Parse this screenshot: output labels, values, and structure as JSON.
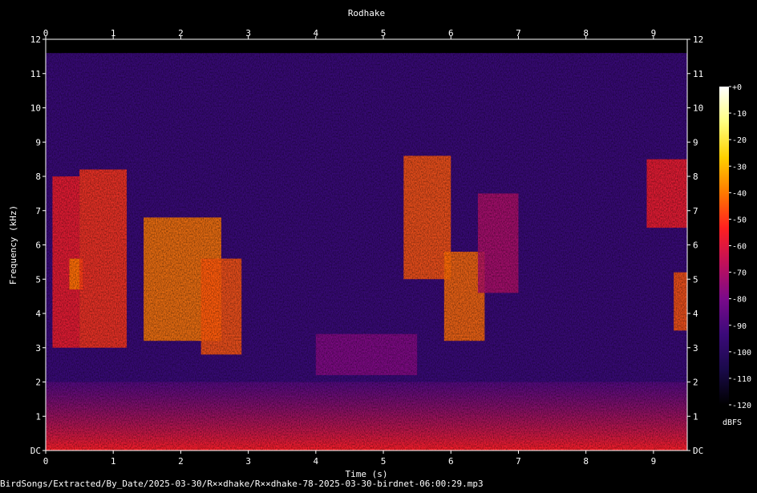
{
  "chart_data": {
    "type": "heatmap",
    "title": "Rodhake",
    "xlabel": "Time (s)",
    "ylabel": "Frequency (kHz)",
    "xlim": [
      0,
      9.5
    ],
    "ylim": [
      0,
      12
    ],
    "x_ticks": [
      "0",
      "1",
      "2",
      "3",
      "4",
      "5",
      "6",
      "7",
      "8",
      "9"
    ],
    "y_ticks": [
      "DC",
      "1",
      "2",
      "3",
      "4",
      "5",
      "6",
      "7",
      "8",
      "9",
      "10",
      "11",
      "12"
    ],
    "colorbar": {
      "label": "dBFS",
      "ticks": [
        "+0",
        "-10",
        "-20",
        "-30",
        "-40",
        "-50",
        "-60",
        "-70",
        "-80",
        "-90",
        "-100",
        "-110",
        "-120"
      ],
      "range": [
        -120,
        0
      ],
      "colors": [
        "#000000",
        "#1a0a4a",
        "#3b0a7a",
        "#7a0a8a",
        "#c0105a",
        "#ff2020",
        "#ff7a00",
        "#ffd000",
        "#ffff80",
        "#ffffff"
      ]
    },
    "background_dbfs": -95,
    "noise_ceiling_khz": 11.6,
    "low_band": {
      "khz_range": [
        0,
        2
      ],
      "dbfs_at_dc": -55,
      "dbfs_at_2khz": -85
    },
    "calls": [
      {
        "t": [
          0.1,
          0.5
        ],
        "khz": [
          3,
          8
        ],
        "peak_dbfs": -55
      },
      {
        "t": [
          0.35,
          0.55
        ],
        "khz": [
          4.7,
          5.6
        ],
        "peak_dbfs": -40
      },
      {
        "t": [
          0.5,
          1.2
        ],
        "khz": [
          3,
          8.2
        ],
        "peak_dbfs": -50
      },
      {
        "t": [
          1.45,
          2.6
        ],
        "khz": [
          3.2,
          6.8
        ],
        "peak_dbfs": -40
      },
      {
        "t": [
          2.3,
          2.9
        ],
        "khz": [
          2.8,
          5.6
        ],
        "peak_dbfs": -45
      },
      {
        "t": [
          4.0,
          5.5
        ],
        "khz": [
          2.2,
          3.4
        ],
        "peak_dbfs": -78
      },
      {
        "t": [
          5.3,
          6.0
        ],
        "khz": [
          5,
          8.6
        ],
        "peak_dbfs": -45
      },
      {
        "t": [
          5.9,
          6.5
        ],
        "khz": [
          3.2,
          5.8
        ],
        "peak_dbfs": -42
      },
      {
        "t": [
          6.4,
          7.0
        ],
        "khz": [
          4.6,
          7.5
        ],
        "peak_dbfs": -70
      },
      {
        "t": [
          8.9,
          9.5
        ],
        "khz": [
          6.5,
          8.5
        ],
        "peak_dbfs": -55
      },
      {
        "t": [
          9.3,
          9.5
        ],
        "khz": [
          3.5,
          5.2
        ],
        "peak_dbfs": -45
      }
    ]
  },
  "footer": {
    "file_path": "BirdSongs/Extracted/By_Date/2025-03-30/R××dhake/R××dhake-78-2025-03-30-birdnet-06:00:29.mp3"
  }
}
